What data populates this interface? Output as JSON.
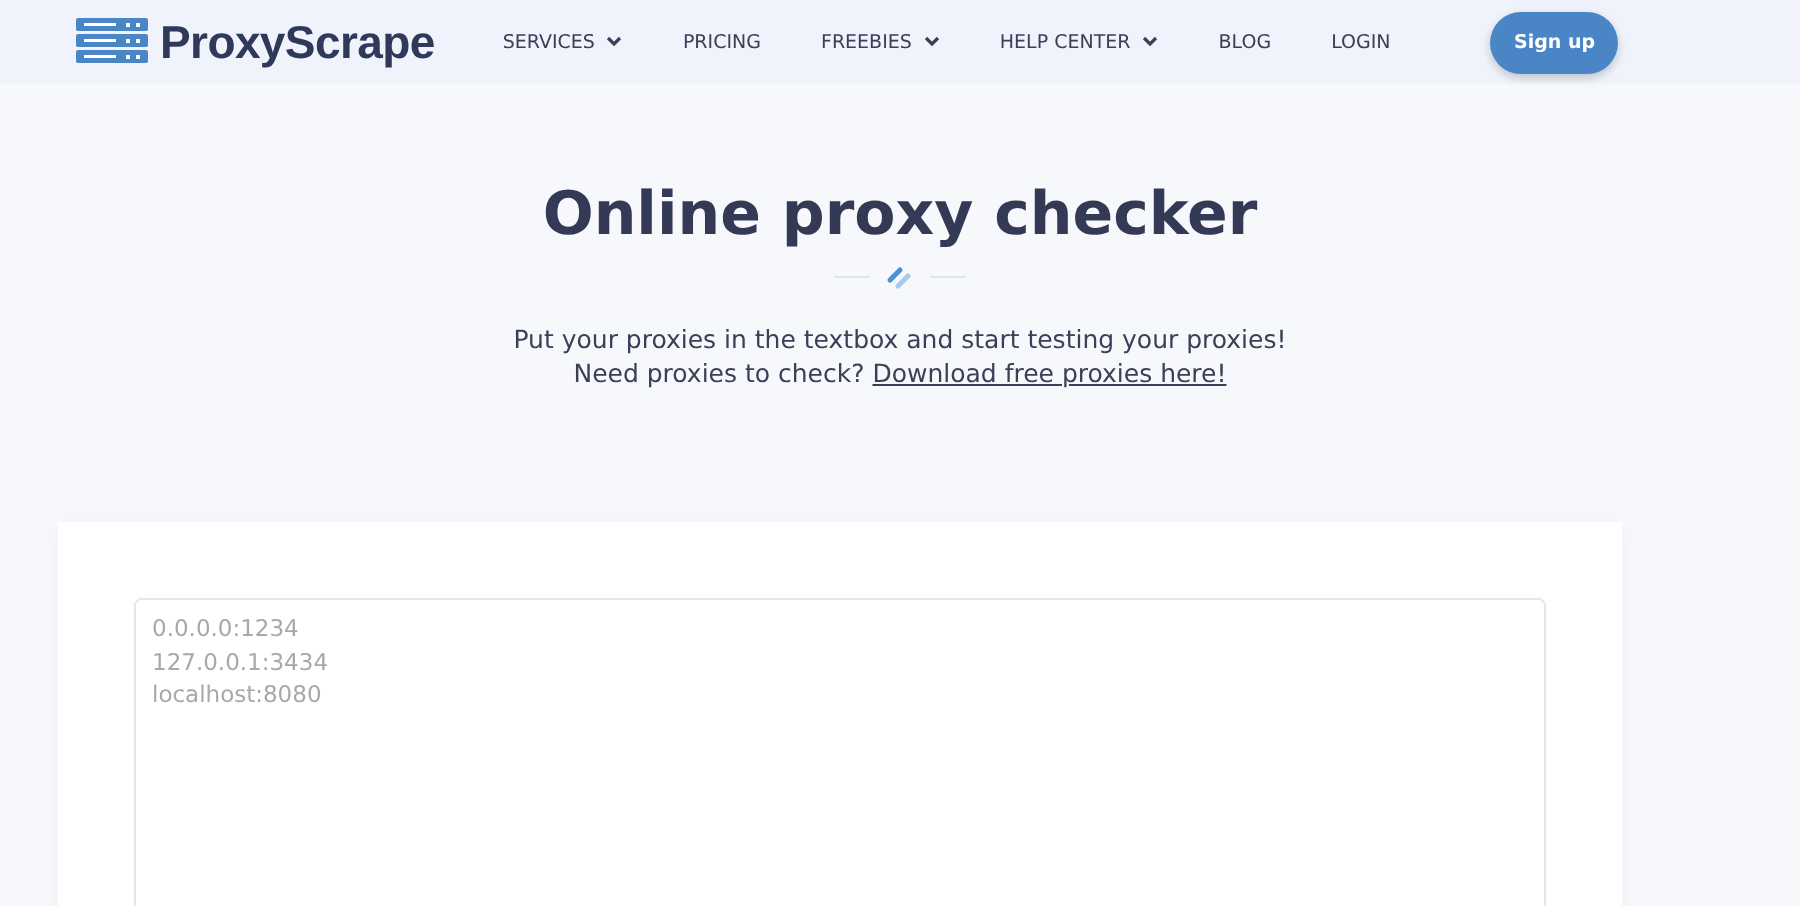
{
  "header": {
    "logo": "ProxyScrape",
    "nav": [
      {
        "label": "SERVICES",
        "dropdown": true
      },
      {
        "label": "PRICING",
        "dropdown": false
      },
      {
        "label": "FREEBIES",
        "dropdown": true
      },
      {
        "label": "HELP CENTER",
        "dropdown": true
      },
      {
        "label": "BLOG",
        "dropdown": false
      },
      {
        "label": "LOGIN",
        "dropdown": false
      }
    ],
    "cta": "Sign up"
  },
  "hero": {
    "title": "Online proxy checker",
    "line1": "Put your proxies in the textbox and start testing your proxies!",
    "line2": "Need proxies to check?",
    "link": "Download free proxies here!"
  },
  "checker": {
    "placeholder": "0.0.0.0:1234\n127.0.0.1:3434\nlocalhost:8080"
  }
}
